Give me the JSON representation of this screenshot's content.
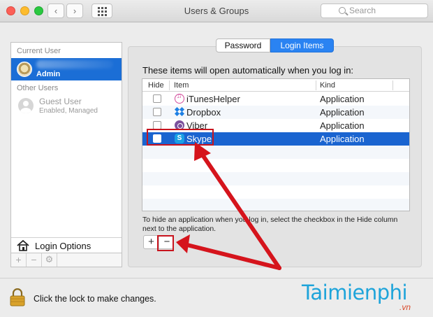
{
  "window": {
    "title": "Users & Groups",
    "search_placeholder": "Search",
    "nav_back": "‹",
    "nav_forward": "›"
  },
  "sidebar": {
    "current_user_header": "Current User",
    "current_user": {
      "name": "Admin"
    },
    "other_users_header": "Other Users",
    "other_users": [
      {
        "name": "Guest User",
        "subtitle": "Enabled, Managed"
      }
    ],
    "login_options_label": "Login Options",
    "buttons": {
      "add": "+",
      "remove": "−",
      "gear": "⚙"
    }
  },
  "tabs": {
    "password": "Password",
    "login_items": "Login Items",
    "selected": "login_items"
  },
  "login_items": {
    "intro": "These items will open automatically when you log in:",
    "columns": {
      "hide": "Hide",
      "item": "Item",
      "kind": "Kind"
    },
    "rows": [
      {
        "name": "iTunesHelper",
        "kind": "Application",
        "icon": "itunes-icon",
        "hidden": false
      },
      {
        "name": "Dropbox",
        "kind": "Application",
        "icon": "dropbox-icon",
        "hidden": false
      },
      {
        "name": "Viber",
        "kind": "Application",
        "icon": "viber-icon",
        "hidden": false
      },
      {
        "name": "Skype",
        "kind": "Application",
        "icon": "skype-icon",
        "hidden": false,
        "selected": true
      }
    ],
    "help_text": "To hide an application when you log in, select the checkbox in the Hide column next to the application.",
    "add_label": "+",
    "remove_label": "−"
  },
  "footer": {
    "lock_text": "Click the lock to make changes."
  },
  "watermark": {
    "brand": "Taimienphi",
    "suffix": ".vn"
  },
  "colors": {
    "selection": "#1a64d0",
    "annotation": "#c8141e",
    "tab_selected": "#2a83f2"
  }
}
